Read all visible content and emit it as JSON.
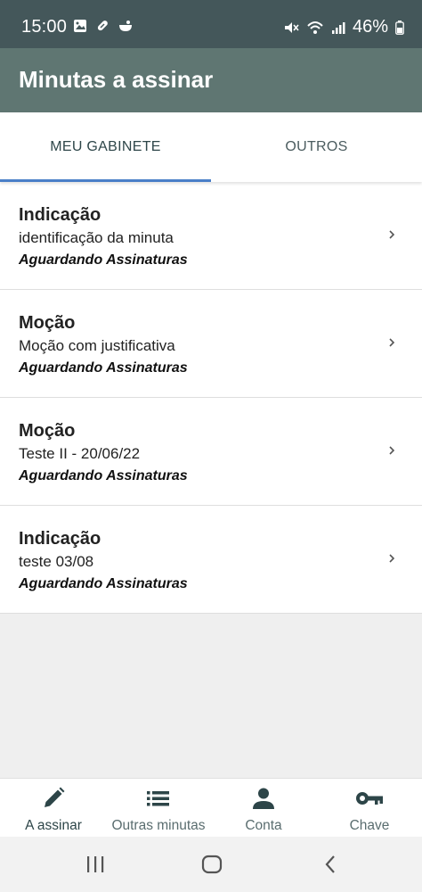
{
  "status_bar": {
    "time": "15:00",
    "battery": "46%",
    "icons_left": [
      "image-icon",
      "pill-icon",
      "bowl-icon"
    ],
    "icons_right": [
      "mute-icon",
      "wifi-icon",
      "signal-icon",
      "battery-icon"
    ]
  },
  "app_bar": {
    "title": "Minutas a assinar"
  },
  "tabs": [
    {
      "label": "MEU GABINETE",
      "active": true
    },
    {
      "label": "OUTROS",
      "active": false
    }
  ],
  "items": [
    {
      "title": "Indicação",
      "description": "identificação da minuta",
      "status": "Aguardando Assinaturas"
    },
    {
      "title": "Moção",
      "description": "Moção com justificativa",
      "status": "Aguardando Assinaturas"
    },
    {
      "title": "Moção",
      "description": "Teste II - 20/06/22",
      "status": "Aguardando Assinaturas"
    },
    {
      "title": "Indicação",
      "description": "teste 03/08",
      "status": "Aguardando Assinaturas"
    }
  ],
  "bottom_nav": [
    {
      "label": "A assinar",
      "icon": "pen-icon",
      "active": true
    },
    {
      "label": "Outras minutas",
      "icon": "list-icon",
      "active": false
    },
    {
      "label": "Conta",
      "icon": "person-icon",
      "active": false
    },
    {
      "label": "Chave",
      "icon": "key-icon",
      "active": false
    }
  ],
  "colors": {
    "status_bar": "#44575a",
    "app_bar": "#5f7672",
    "tab_indicator": "#4a7fc8",
    "icon_dark": "#2d4548"
  }
}
